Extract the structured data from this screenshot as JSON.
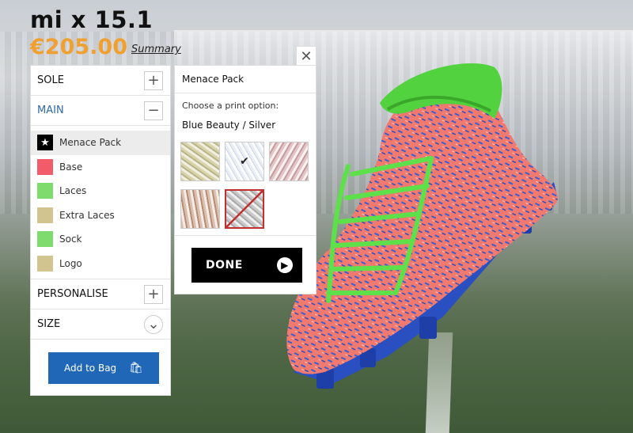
{
  "product": {
    "title": "mi x 15.1",
    "price": "€205.00",
    "summary_link": "Summary"
  },
  "panel": {
    "sections": {
      "sole": {
        "label": "SOLE",
        "toggle": "+"
      },
      "main": {
        "label": "MAIN",
        "toggle": "−"
      },
      "personalise": {
        "label": "PERSONALISE",
        "toggle": "+"
      },
      "size": {
        "label": "SIZE",
        "toggle": "⌄"
      }
    },
    "main_items": [
      {
        "label": "Menace Pack",
        "color": "#000000",
        "icon": "star-icon",
        "selected": true
      },
      {
        "label": "Base",
        "color": "#f25c6a"
      },
      {
        "label": "Laces",
        "color": "#7edb6e"
      },
      {
        "label": "Extra Laces",
        "color": "#d2c48e"
      },
      {
        "label": "Sock",
        "color": "#7edb6e"
      },
      {
        "label": "Logo",
        "color": "#d2c48e"
      }
    ],
    "add_to_bag": "Add to Bag"
  },
  "popup": {
    "title": "Menace Pack",
    "choose_label": "Choose a print option:",
    "selected_option": "Blue Beauty / Silver",
    "thumbnails_selected_index": 1,
    "done_label": "DONE",
    "close_icon": "close-icon"
  },
  "colors": {
    "accent_blue": "#2067b8",
    "price_orange": "#f0a030",
    "main_blue": "#2f6aa6"
  }
}
